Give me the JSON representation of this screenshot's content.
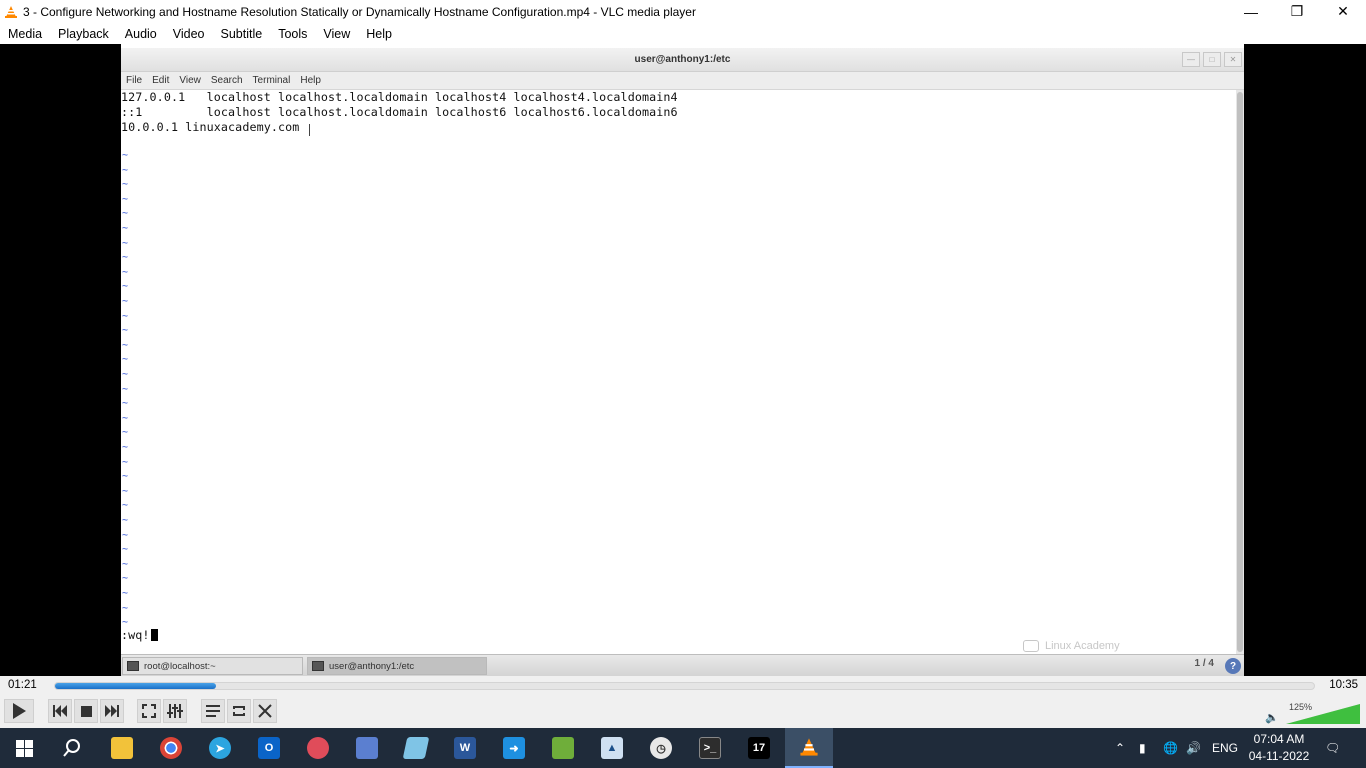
{
  "window": {
    "title": "3 - Configure Networking and Hostname Resolution Statically or Dynamically Hostname Configuration.mp4 - VLC media player",
    "controls": [
      "minimize-icon",
      "restore-icon",
      "close-icon"
    ]
  },
  "menu": [
    "Media",
    "Playback",
    "Audio",
    "Video",
    "Subtitle",
    "Tools",
    "View",
    "Help"
  ],
  "terminal": {
    "title": "user@anthony1:/etc",
    "menu": [
      "File",
      "Edit",
      "View",
      "Search",
      "Terminal",
      "Help"
    ],
    "lines": [
      "127.0.0.1   localhost localhost.localdomain localhost4 localhost4.localdomain4",
      "::1         localhost localhost.localdomain localhost6 localhost6.localdomain6",
      "10.0.0.1 linuxacademy.com"
    ],
    "tilde": "~",
    "command": ":wq!",
    "watermark": "Linux Academy",
    "tasks": [
      {
        "label": "root@localhost:~"
      },
      {
        "label": "user@anthony1:/etc"
      }
    ],
    "pager": "1 / 4",
    "help_glyph": "?"
  },
  "player": {
    "elapsed": "01:21",
    "total": "10:35",
    "progress_fraction": 0.1276,
    "volume_percent": "125%",
    "volume_level": 1.25,
    "buttons": [
      "play-icon",
      "previous-icon",
      "stop-icon",
      "next-icon",
      "fullscreen-icon",
      "extended-settings-icon",
      "playlist-icon",
      "loop-icon",
      "shuffle-icon"
    ]
  },
  "taskbar": {
    "apps": [
      "start-icon",
      "search-icon",
      "file-explorer-icon",
      "chrome-icon",
      "telegram-icon",
      "outlook-icon",
      "snipping-icon",
      "network-icon",
      "notes-icon",
      "word-icon",
      "remote-icon",
      "sheet-icon",
      "virtualbox-icon",
      "clock-app-icon",
      "terminal-icon",
      "tradingview-icon",
      "vlc-icon"
    ],
    "language": "ENG",
    "time": "07:04 AM",
    "date": "04-11-2022"
  },
  "colors": {
    "taskbar_bg": "#1f2b3a",
    "seek_fill": "#1a70c8",
    "vim_tilde": "#2a4fd4",
    "vlc_orange": "#ff8800"
  }
}
